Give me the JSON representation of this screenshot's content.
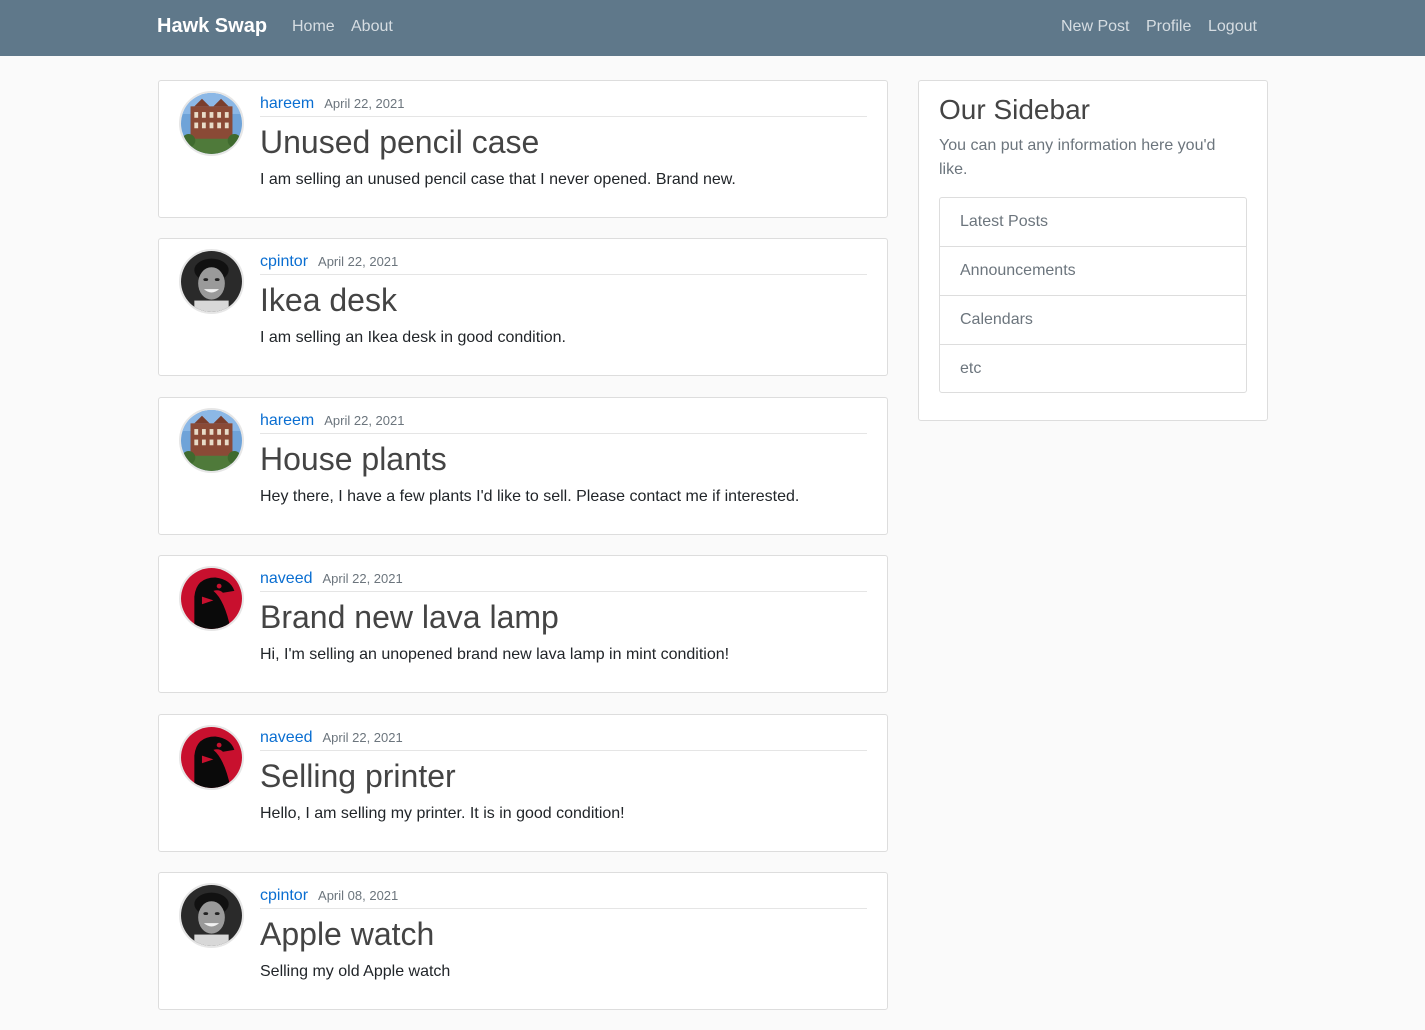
{
  "navbar": {
    "brand": "Hawk Swap",
    "left_links": [
      "Home",
      "About"
    ],
    "right_links": [
      "New Post",
      "Profile",
      "Logout"
    ],
    "background": "#5f788a"
  },
  "posts": [
    {
      "author": "hareem",
      "date": "April 22, 2021",
      "title": "Unused pencil case",
      "content": "I am selling an unused pencil case that I never opened. Brand new.",
      "avatar": "building-photo-avatar"
    },
    {
      "author": "cpintor",
      "date": "April 22, 2021",
      "title": "Ikea desk",
      "content": "I am selling an Ikea desk in good condition.",
      "avatar": "person-photo-avatar"
    },
    {
      "author": "hareem",
      "date": "April 22, 2021",
      "title": "House plants",
      "content": "Hey there, I have a few plants I'd like to sell. Please contact me if interested.",
      "avatar": "building-photo-avatar"
    },
    {
      "author": "naveed",
      "date": "April 22, 2021",
      "title": "Brand new lava lamp",
      "content": "Hi, I'm selling an unopened brand new lava lamp in mint condition!",
      "avatar": "hawk-logo-avatar"
    },
    {
      "author": "naveed",
      "date": "April 22, 2021",
      "title": "Selling printer",
      "content": "Hello, I am selling my printer. It is in good condition!",
      "avatar": "hawk-logo-avatar"
    },
    {
      "author": "cpintor",
      "date": "April 08, 2021",
      "title": "Apple watch",
      "content": "Selling my old Apple watch",
      "avatar": "person-photo-avatar"
    }
  ],
  "sidebar": {
    "title": "Our Sidebar",
    "description": "You can put any information here you'd like.",
    "items": [
      "Latest Posts",
      "Announcements",
      "Calendars",
      "etc"
    ]
  },
  "colors": {
    "link": "#0a6ed1",
    "muted": "#6c757d",
    "hawk_red": "#c8102e"
  }
}
